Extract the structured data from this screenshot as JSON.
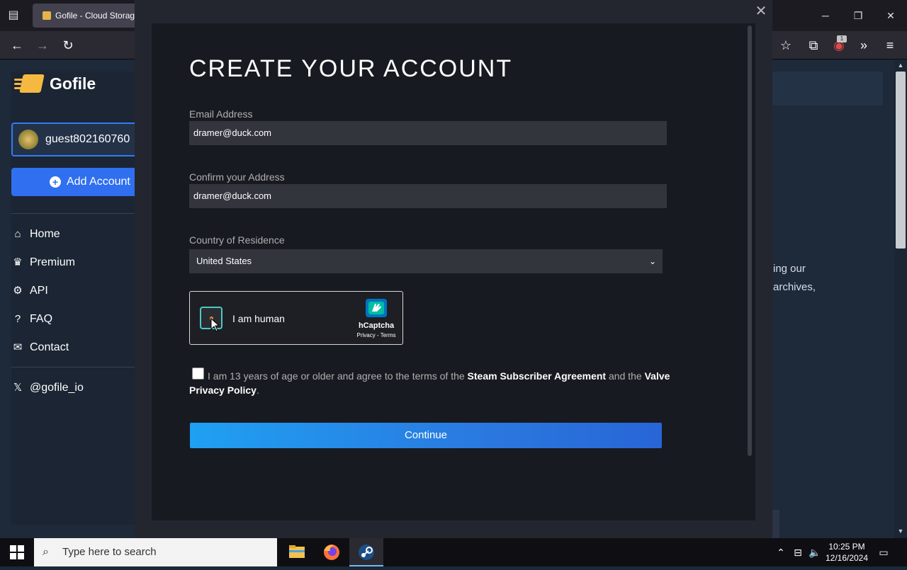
{
  "browser": {
    "tab_title": "Gofile - Cloud Storage",
    "icons": [
      "tab-list-icon",
      "back-arrow-icon",
      "forward-arrow-icon",
      "reload-icon",
      "bookmark-star-icon",
      "extensions-icon",
      "ublock-icon",
      "overflow-chevron-icon",
      "hamburger-menu-icon"
    ],
    "ublock_badge": "1"
  },
  "site": {
    "logo_text": "Gofile",
    "account_name": "guest802160760",
    "add_account_label": "Add Account",
    "nav": [
      {
        "label": "Home",
        "icon": "home-icon"
      },
      {
        "label": "Premium",
        "icon": "crown-icon"
      },
      {
        "label": "API",
        "icon": "gears-icon"
      },
      {
        "label": "FAQ",
        "icon": "question-icon"
      },
      {
        "label": "Contact",
        "icon": "envelope-icon"
      }
    ],
    "social": {
      "label": "@gofile_io",
      "icon": "x-logo-icon"
    },
    "body_line1": "ing our",
    "body_line2": "archives,"
  },
  "modal": {
    "title": "CREATE YOUR ACCOUNT",
    "email_label": "Email Address",
    "email_value": "dramer@duck.com",
    "confirm_label": "Confirm your Address",
    "confirm_value": "dramer@duck.com",
    "country_label": "Country of Residence",
    "country_value": "United States",
    "captcha": {
      "label": "I am human",
      "brand": "hCaptcha",
      "links": "Privacy - Terms"
    },
    "agree": {
      "prefix": "I am 13 years of age or older and agree to the terms of the ",
      "link1": "Steam Subscriber Agreement",
      "middle": " and the ",
      "link2": "Valve Privacy Policy",
      "suffix": "."
    },
    "continue_label": "Continue"
  },
  "taskbar": {
    "search_placeholder": "Type here to search",
    "time": "10:25 PM",
    "date": "12/16/2024"
  },
  "colors": {
    "accent": "#2f6ff0",
    "continue_start": "#1fa0f2",
    "continue_end": "#2865d6",
    "modal_bg": "#181a21",
    "field_bg": "#32353c"
  }
}
